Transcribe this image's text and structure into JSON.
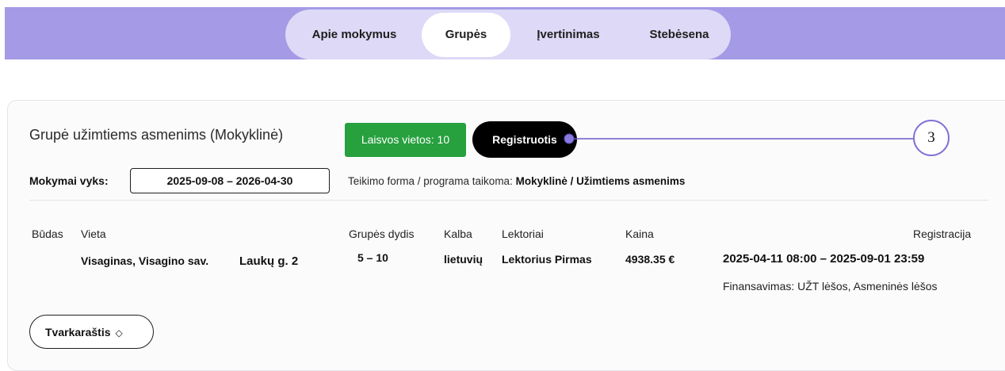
{
  "nav": {
    "tabs": [
      {
        "label": "Apie mokymus",
        "active": false
      },
      {
        "label": "Grupės",
        "active": true
      },
      {
        "label": "Įvertinimas",
        "active": false
      },
      {
        "label": "Stebėsena",
        "active": false
      }
    ]
  },
  "group": {
    "title": "Grupė užimtiems asmenims (Mokyklinė)",
    "free_places": "Laisvos vietos: 10",
    "register_label": "Registruotis",
    "step_number": "3",
    "dates_label": "Mokymai vyks:",
    "dates_value": "2025-09-08 – 2026-04-30",
    "form_prefix": "Teikimo forma / programa taikoma:",
    "form_value": "Mokyklinė / Užimtiems asmenims"
  },
  "table": {
    "headers": {
      "budas": "Būdas",
      "vieta": "Vieta",
      "dydis": "Grupės dydis",
      "kalba": "Kalba",
      "lektoriai": "Lektoriai",
      "kaina": "Kaina",
      "registracija": "Registracija"
    },
    "row": {
      "vieta": "Visaginas, Visagino sav.",
      "adresas": "Laukų g. 2",
      "dydis": "5 – 10",
      "kalba": "lietuvių",
      "lektoriai": "Lektorius Pirmas",
      "kaina": "4938.35 €",
      "registracija": "2025-04-11 08:00 – 2025-09-01 23:59",
      "finansavimas": "Finansavimas: UŽT lėšos, Asmeninės lėšos"
    }
  },
  "schedule": {
    "label": "Tvarkaraštis",
    "icon": "chevron-up-down-icon"
  },
  "colors": {
    "nav_band": "#a49ae6",
    "nav_pill": "#ddd9f6",
    "free_badge": "#27a03e",
    "register_button": "#000000",
    "annotation": "#8272d4"
  }
}
